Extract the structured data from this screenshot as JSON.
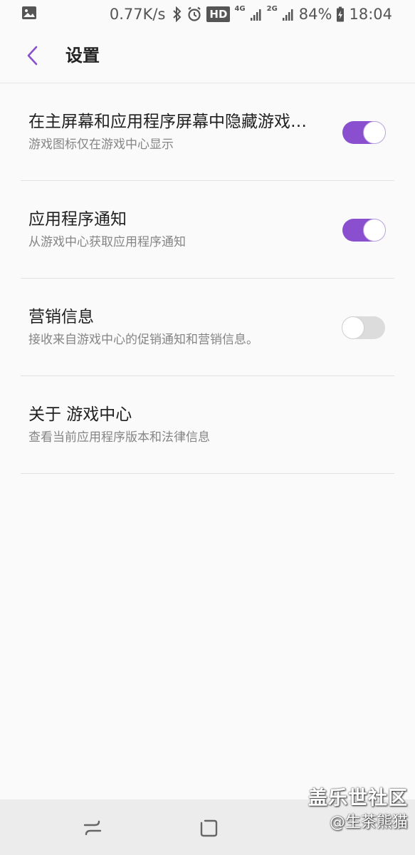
{
  "status_bar": {
    "net_speed": "0.77K/s",
    "hd_badge": "HD",
    "network_4g": "4G",
    "network_2g": "2G",
    "battery": "84%",
    "time": "18:04"
  },
  "header": {
    "title": "设置"
  },
  "settings": [
    {
      "title": "在主屏幕和应用程序屏幕中隐藏游戏图标",
      "subtitle": "游戏图标仅在游戏中心显示",
      "toggle": "on"
    },
    {
      "title": "应用程序通知",
      "subtitle": "从游戏中心获取应用程序通知",
      "toggle": "on"
    },
    {
      "title": "营销信息",
      "subtitle": "接收来自游戏中心的促销通知和营销信息。",
      "toggle": "off"
    },
    {
      "title": "关于 游戏中心",
      "subtitle": "查看当前应用程序版本和法律信息"
    }
  ],
  "watermark": {
    "line1": "盖乐世社区",
    "line2": "@生茶熊猫"
  },
  "colors": {
    "accent": "#8a4fcf",
    "toggle_off": "#dcdcdc",
    "background": "#fafafa"
  }
}
